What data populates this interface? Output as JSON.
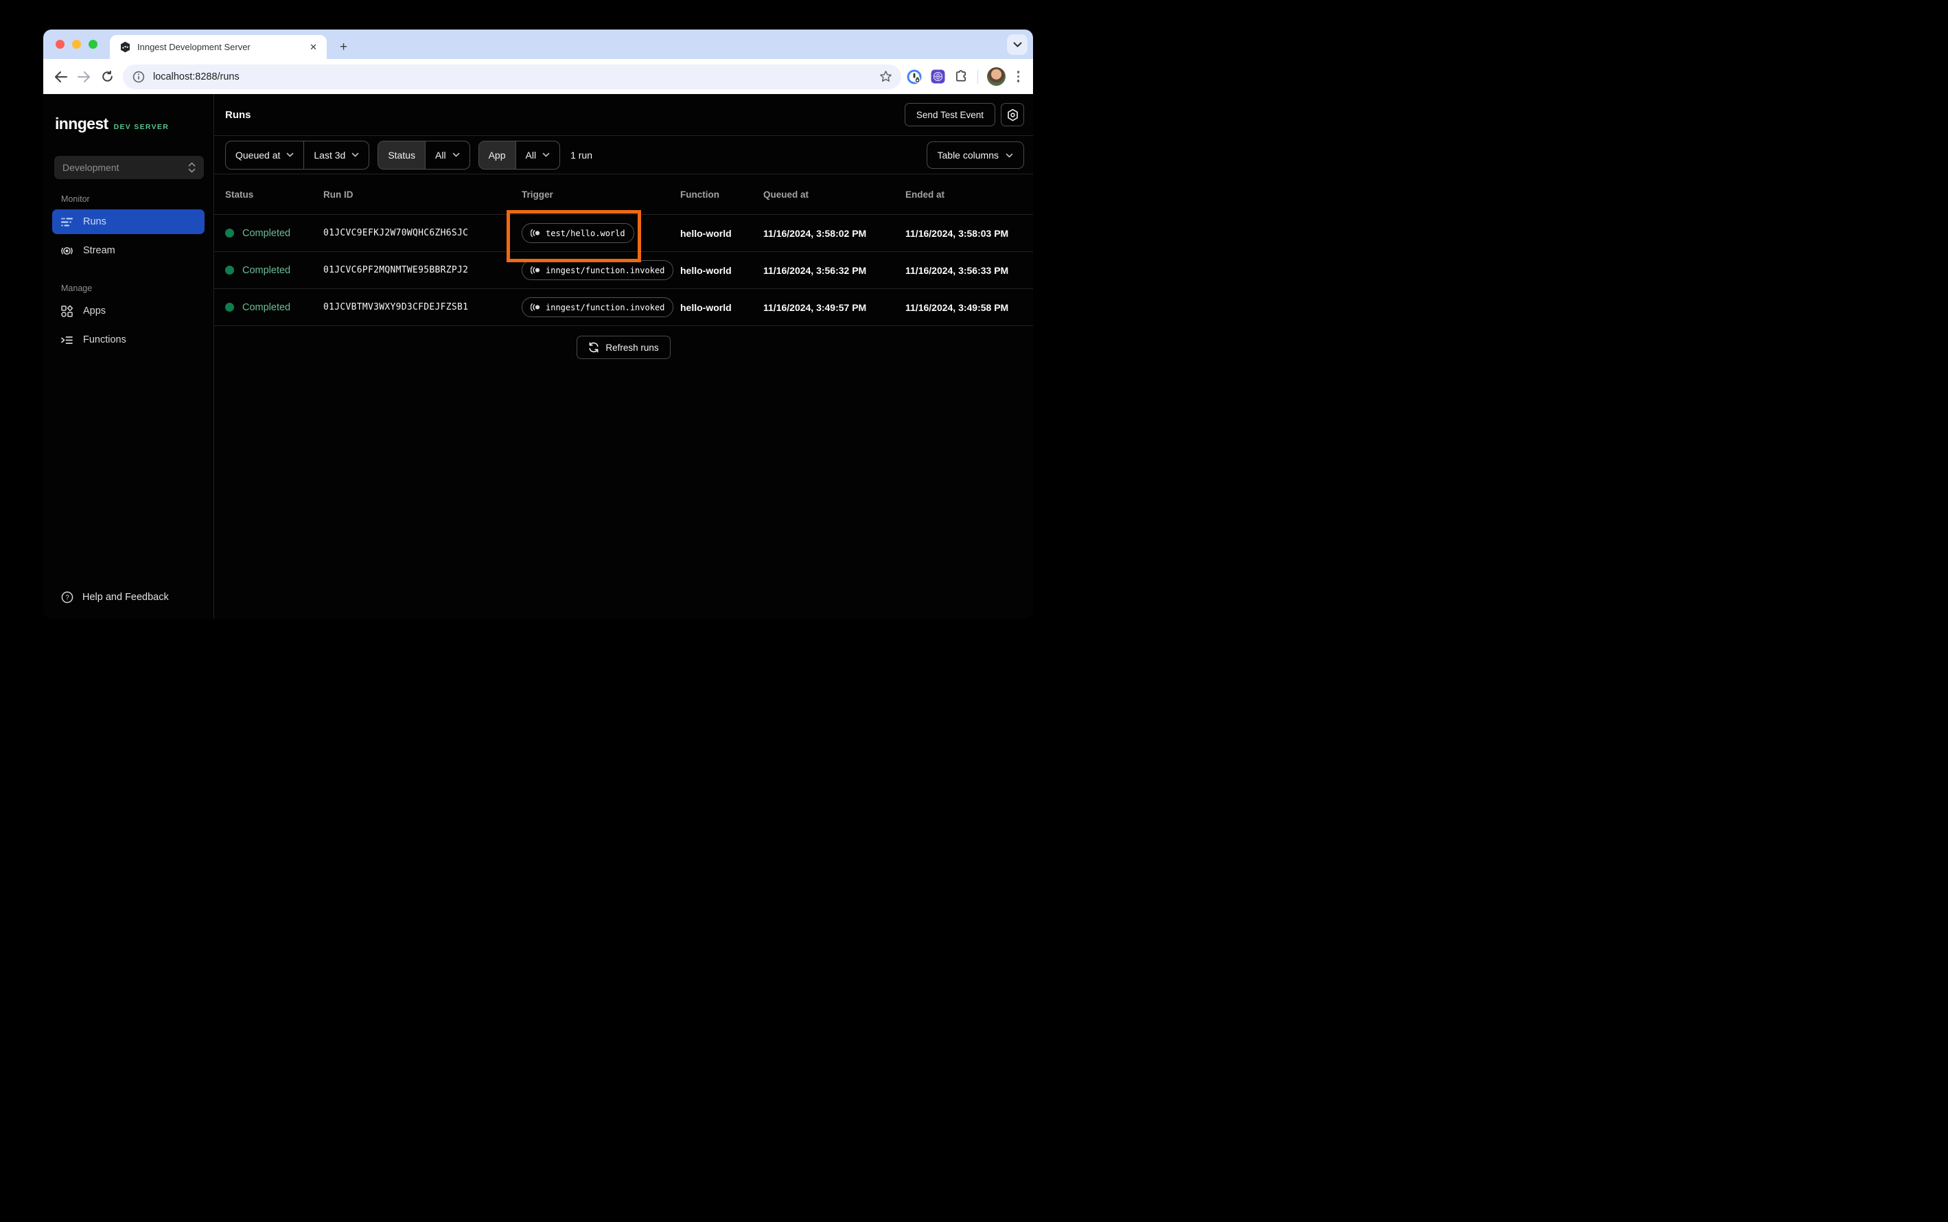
{
  "browser": {
    "tab_title": "Inngest Development Server",
    "close_tab": "✕",
    "new_tab": "+",
    "url": "localhost:8288/runs"
  },
  "sidebar": {
    "logo": "inngest",
    "badge": "DEV SERVER",
    "env_select": "Development",
    "sections": [
      {
        "label": "Monitor",
        "items": [
          {
            "label": "Runs",
            "active": true
          },
          {
            "label": "Stream",
            "active": false
          }
        ]
      },
      {
        "label": "Manage",
        "items": [
          {
            "label": "Apps",
            "active": false
          },
          {
            "label": "Functions",
            "active": false
          }
        ]
      }
    ],
    "help": "Help and Feedback"
  },
  "header": {
    "title": "Runs",
    "send_test_event": "Send Test Event"
  },
  "filters": {
    "field": "Queued at",
    "range": "Last 3d",
    "status_label": "Status",
    "status_value": "All",
    "app_label": "App",
    "app_value": "All",
    "result_count": "1 run",
    "table_columns": "Table columns"
  },
  "table": {
    "columns": [
      "Status",
      "Run ID",
      "Trigger",
      "Function",
      "Queued at",
      "Ended at"
    ],
    "rows": [
      {
        "status": "Completed",
        "run_id": "01JCVC9EFKJ2W70WQHC6ZH6SJC",
        "trigger": "test/hello.world",
        "function": "hello-world",
        "queued_at": "11/16/2024, 3:58:02 PM",
        "ended_at": "11/16/2024, 3:58:03 PM"
      },
      {
        "status": "Completed",
        "run_id": "01JCVC6PF2MQNMTWE95BBRZPJ2",
        "trigger": "inngest/function.invoked",
        "function": "hello-world",
        "queued_at": "11/16/2024, 3:56:32 PM",
        "ended_at": "11/16/2024, 3:56:33 PM"
      },
      {
        "status": "Completed",
        "run_id": "01JCVBTMV3WXY9D3CFDEJFZSB1",
        "trigger": "inngest/function.invoked",
        "function": "hello-world",
        "queued_at": "11/16/2024, 3:49:57 PM",
        "ended_at": "11/16/2024, 3:49:58 PM"
      }
    ]
  },
  "actions": {
    "refresh": "Refresh runs"
  },
  "colors": {
    "highlight_orange": "#EE6A10",
    "brand_green": "#56C48F",
    "status_dot_green": "#0E7E4E",
    "status_text_green": "#68BD96",
    "active_nav_blue": "#1D4DBC"
  }
}
